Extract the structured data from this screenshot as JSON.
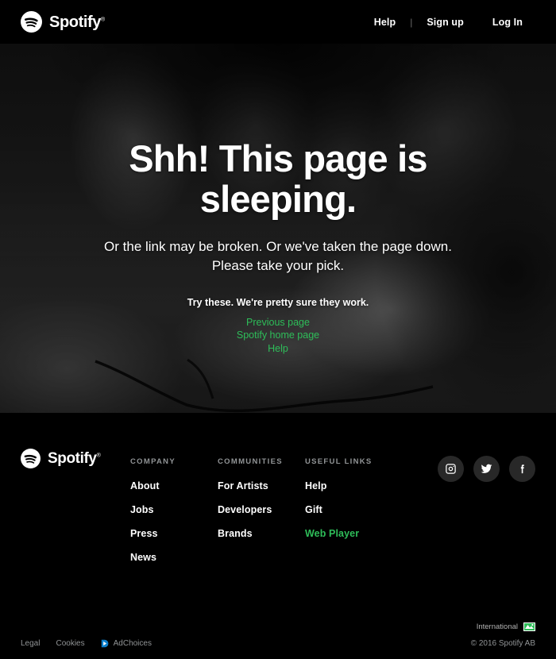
{
  "header": {
    "logo": {
      "mark": "spotify-logo-icon",
      "name": "Spotify",
      "trademark": "®"
    },
    "nav": [
      {
        "label": "Help",
        "name": "help"
      },
      {
        "label": "|",
        "name": "divider"
      },
      {
        "label": "Sign up",
        "name": "sign-up"
      },
      {
        "label": "Log In",
        "name": "log-in"
      }
    ]
  },
  "hero": {
    "title": "Shh! This page is sleeping.",
    "subtitle": "Or the link may be broken. Or we've taken the page down. Please take your pick.",
    "try_text": "Try these. We're pretty sure they work.",
    "links": [
      {
        "label": "Previous page",
        "name": "previous-page"
      },
      {
        "label": "Spotify home page",
        "name": "spotify-home-page"
      },
      {
        "label": "Help",
        "name": "help"
      }
    ],
    "link_color": "#2ebd59",
    "image_description": "blurred grayscale photo of a person sleeping with earphones"
  },
  "footer": {
    "logo": {
      "mark": "spotify-logo-icon",
      "name": "Spotify",
      "trademark": "®"
    },
    "columns": [
      {
        "heading": "COMPANY",
        "name": "company",
        "links": [
          {
            "label": "About",
            "green": false
          },
          {
            "label": "Jobs",
            "green": false
          },
          {
            "label": "Press",
            "green": false
          },
          {
            "label": "News",
            "green": false
          }
        ]
      },
      {
        "heading": "COMMUNITIES",
        "name": "communities",
        "links": [
          {
            "label": "For Artists",
            "green": false
          },
          {
            "label": "Developers",
            "green": false
          },
          {
            "label": "Brands",
            "green": false
          }
        ]
      },
      {
        "heading": "USEFUL LINKS",
        "name": "useful-links",
        "links": [
          {
            "label": "Help",
            "green": false
          },
          {
            "label": "Gift",
            "green": false
          },
          {
            "label": "Web Player",
            "green": true
          }
        ]
      }
    ],
    "social": [
      {
        "name": "instagram-icon",
        "label": "Instagram"
      },
      {
        "name": "twitter-icon",
        "label": "Twitter"
      },
      {
        "name": "facebook-icon",
        "label": "Facebook"
      }
    ],
    "international": {
      "label": "International",
      "flag": "international-flag-icon"
    },
    "legal": [
      {
        "label": "Legal",
        "name": "legal"
      },
      {
        "label": "Cookies",
        "name": "cookies"
      }
    ],
    "adchoices": {
      "label": "AdChoices",
      "icon": "adchoices-icon"
    },
    "copyright": "© 2016 Spotify AB"
  },
  "colors": {
    "green": "#2ebd59",
    "background": "#000000",
    "muted": "#919496",
    "social_bg": "#282828"
  }
}
